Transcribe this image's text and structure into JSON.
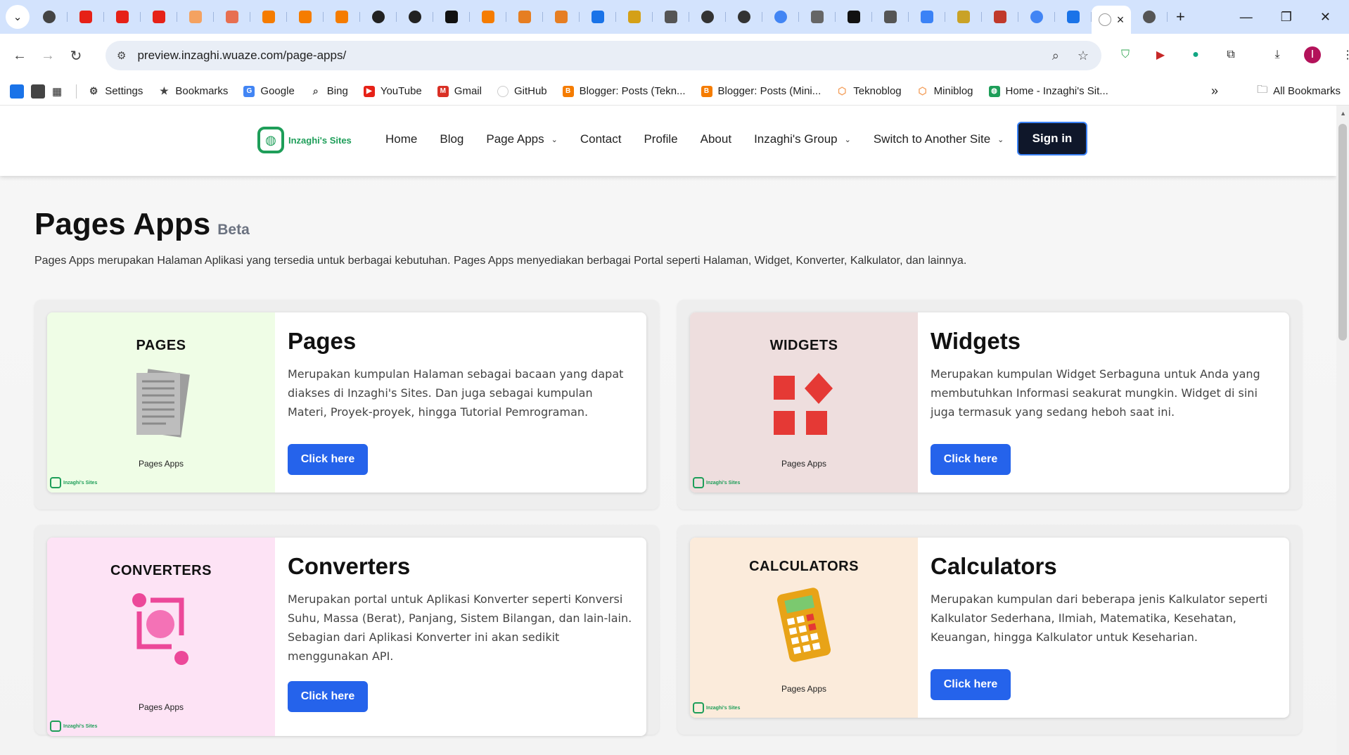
{
  "browser": {
    "tab_icons": [
      "chrome-icon",
      "youtube-icon",
      "youtube-icon",
      "youtube-icon",
      "hexagon-icon",
      "brand-icon",
      "blogger-icon",
      "blogger-icon",
      "blogger-icon",
      "openai-icon",
      "openai-icon",
      "notion-icon",
      "orange-icon",
      "copy-icon",
      "copy-icon",
      "blue-square-icon",
      "folder-icon",
      "braces-icon",
      "github-icon",
      "github-icon",
      "google-icon",
      "vpn-icon",
      "bookmark-icon",
      "gray-square-icon",
      "star-icon",
      "photo-icon",
      "trello-icon",
      "google-icon",
      "ai-icon"
    ],
    "active_tab_close": "×",
    "new_tab": "+",
    "url": "preview.inzaghi.wuaze.com/page-apps/",
    "bookmarks": [
      {
        "label": "Settings",
        "icon": "gear-icon"
      },
      {
        "label": "Bookmarks",
        "icon": "star-icon"
      },
      {
        "label": "Google",
        "icon": "google-icon"
      },
      {
        "label": "Bing",
        "icon": "search-icon"
      },
      {
        "label": "YouTube",
        "icon": "youtube-icon"
      },
      {
        "label": "Gmail",
        "icon": "gmail-icon"
      },
      {
        "label": "GitHub",
        "icon": "github-icon"
      },
      {
        "label": "Blogger: Posts (Tekn...",
        "icon": "blogger-icon"
      },
      {
        "label": "Blogger: Posts (Mini...",
        "icon": "blogger-icon"
      },
      {
        "label": "Teknoblog",
        "icon": "hexagon-icon"
      },
      {
        "label": "Miniblog",
        "icon": "hexagon-icon"
      },
      {
        "label": "Home - Inzaghi's Sit...",
        "icon": "site-icon"
      }
    ],
    "all_bookmarks": "All Bookmarks",
    "avatar_letter": "I"
  },
  "site": {
    "logo_text": "Inzaghi's Sites",
    "menu": [
      {
        "label": "Home",
        "dropdown": false
      },
      {
        "label": "Blog",
        "dropdown": false
      },
      {
        "label": "Page Apps",
        "dropdown": true
      },
      {
        "label": "Contact",
        "dropdown": false
      },
      {
        "label": "Profile",
        "dropdown": false
      },
      {
        "label": "About",
        "dropdown": false
      },
      {
        "label": "Inzaghi's Group",
        "dropdown": true
      },
      {
        "label": "Switch to Another Site",
        "dropdown": true
      }
    ],
    "signin": "Sign in",
    "brand_color": "#1e9e59",
    "button_color": "#2563eb"
  },
  "page": {
    "title": "Pages Apps",
    "badge": "Beta",
    "intro": "Pages Apps merupakan Halaman Aplikasi yang tersedia untuk berbagai kebutuhan. Pages Apps menyediakan berbagai Portal seperti Halaman, Widget, Konverter, Kalkulator, dan lainnya.",
    "cards": [
      {
        "thumb_title": "PAGES",
        "thumb_sub": "Pages Apps",
        "thumb_logo": "Inzaghi's Sites",
        "thumb_bg": "#effde6",
        "icon": "document-stack-icon",
        "title": "Pages",
        "desc": "Merupakan kumpulan Halaman sebagai bacaan yang dapat diakses di Inzaghi's Sites. Dan juga sebagai kumpulan Materi, Proyek-proyek, hingga Tutorial Pemrograman.",
        "button": "Click here"
      },
      {
        "thumb_title": "WIDGETS",
        "thumb_sub": "Pages Apps",
        "thumb_logo": "Inzaghi's Sites",
        "thumb_bg": "#eedede",
        "icon": "widgets-icon",
        "title": "Widgets",
        "desc": "Merupakan kumpulan Widget Serbaguna untuk Anda yang membutuhkan Informasi seakurat mungkin. Widget di sini juga termasuk yang sedang heboh saat ini.",
        "button": "Click here"
      },
      {
        "thumb_title": "CONVERTERS",
        "thumb_sub": "Pages Apps",
        "thumb_logo": "Inzaghi's Sites",
        "thumb_bg": "#fde3f5",
        "icon": "currency-exchange-icon",
        "title": "Converters",
        "desc": "Merupakan portal untuk Aplikasi Konverter seperti Konversi Suhu, Massa (Berat), Panjang, Sistem Bilangan, dan lain-lain. Sebagian dari Aplikasi Konverter ini akan sedikit menggunakan API.",
        "button": "Click here"
      },
      {
        "thumb_title": "CALCULATORS",
        "thumb_sub": "Pages Apps",
        "thumb_logo": "Inzaghi's Sites",
        "thumb_bg": "#fbebdb",
        "icon": "calculator-icon",
        "title": "Calculators",
        "desc": "Merupakan kumpulan dari beberapa jenis Kalkulator seperti Kalkulator Sederhana, Ilmiah, Matematika, Kesehatan, Keuangan, hingga Kalkulator untuk Keseharian.",
        "button": "Click here"
      }
    ]
  }
}
